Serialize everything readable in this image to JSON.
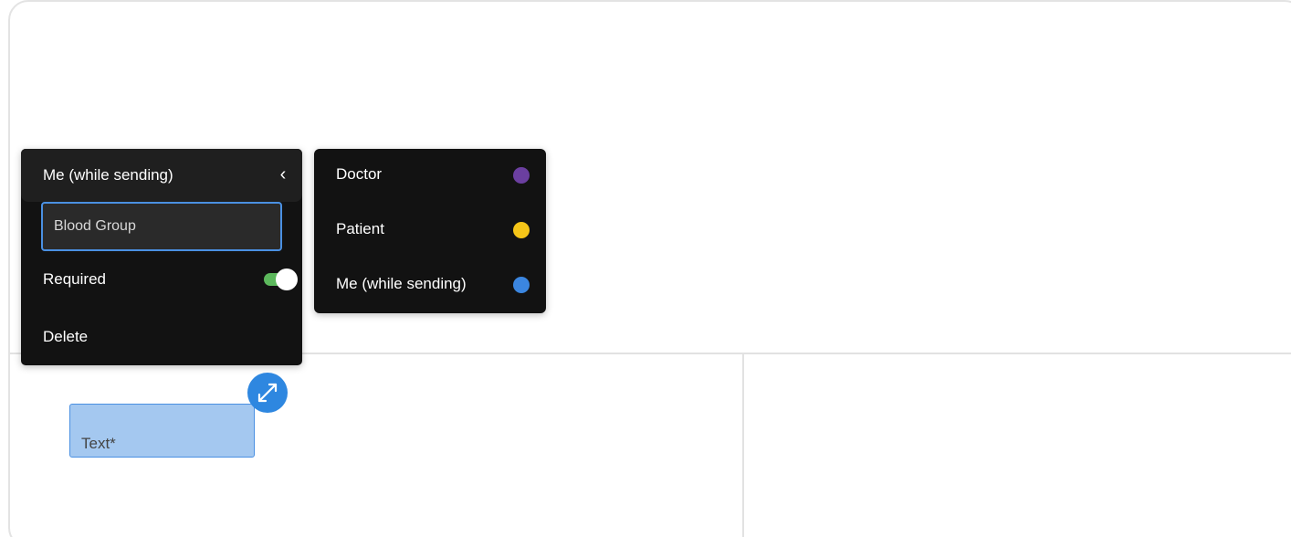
{
  "field_panel": {
    "assignee": "Me (while sending)",
    "field_name_value": "Blood Group",
    "required_label": "Required",
    "required_on": true,
    "delete_label": "Delete",
    "collapse_icon": "chevron-left-icon"
  },
  "recipient_menu": {
    "options": [
      {
        "label": "Doctor",
        "color": "#6b3fa0"
      },
      {
        "label": "Patient",
        "color": "#f5c518"
      },
      {
        "label": "Me (while sending)",
        "color": "#3b86e0"
      }
    ]
  },
  "document": {
    "text_field_label": "Text*",
    "resize_icon": "expand-arrows-icon",
    "field_fill": "#a4c8f0",
    "accent": "#2e87e0"
  }
}
